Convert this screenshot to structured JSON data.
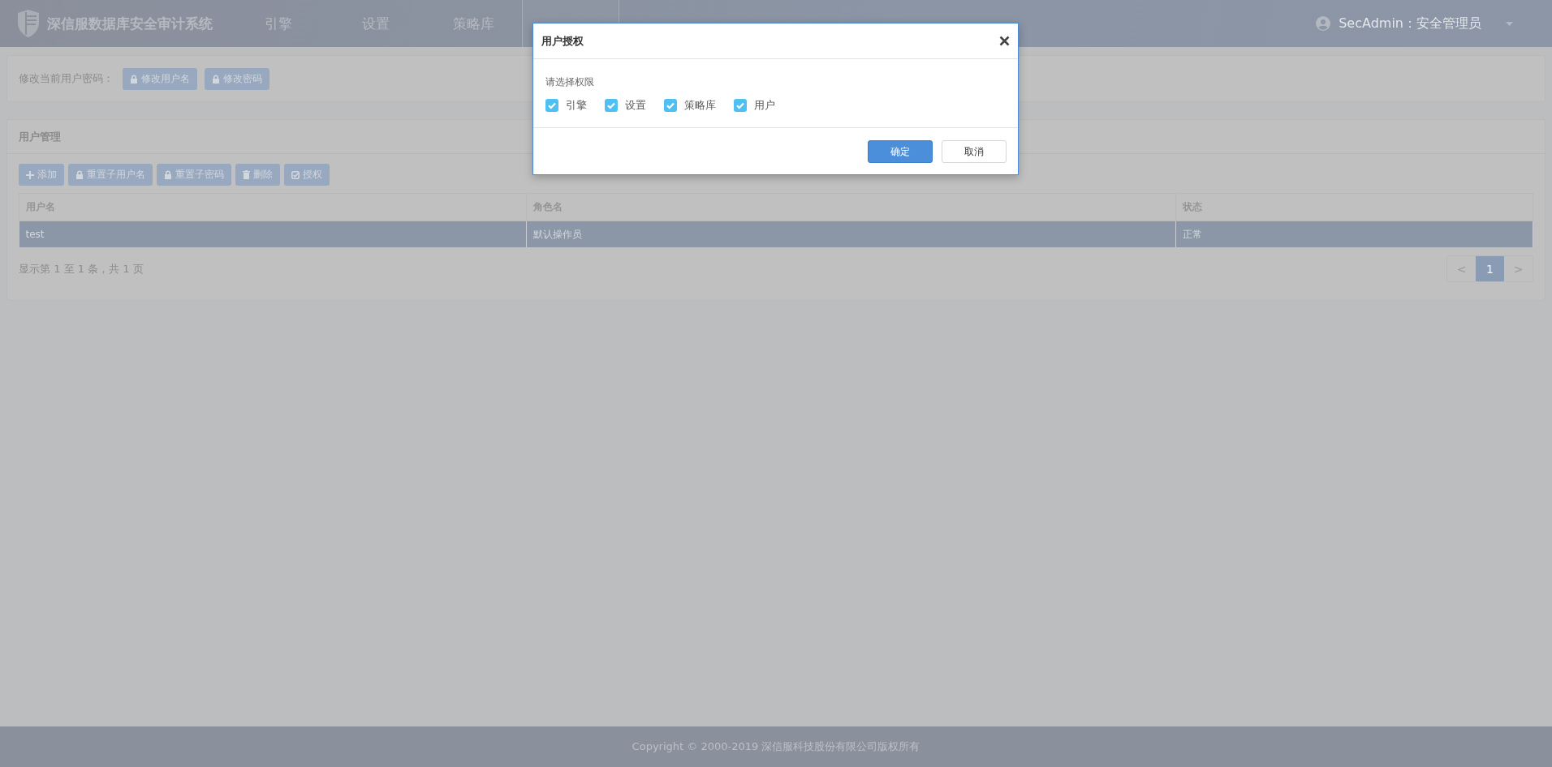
{
  "header": {
    "title": "深信服数据库安全审计系统",
    "nav": [
      {
        "label": "引擎",
        "selected": false
      },
      {
        "label": "设置",
        "selected": false
      },
      {
        "label": "策略库",
        "selected": false
      },
      {
        "selected": true
      }
    ],
    "user": "SecAdmin：安全管理员"
  },
  "account_panel": {
    "label": "修改当前用户密码：",
    "buttons": [
      "修改用户名",
      "修改密码"
    ]
  },
  "user_panel": {
    "title": "用户管理",
    "toolbar": [
      {
        "label": "添加",
        "kind": "plus"
      },
      {
        "label": "重置子用户名",
        "kind": "lock"
      },
      {
        "label": "重置子密码",
        "kind": "lock"
      },
      {
        "label": "删除",
        "kind": "trash"
      },
      {
        "label": "授权",
        "kind": "check"
      }
    ],
    "table": {
      "columns": [
        "用户名",
        "角色名",
        "状态"
      ],
      "rows": [
        {
          "cells": [
            "test",
            "默认操作员",
            "正常"
          ],
          "selected": true
        }
      ]
    },
    "info": "显示第 1 至 1 条，共 1 页",
    "pagination": [
      {
        "label": "<",
        "selected": false
      },
      {
        "label": "1",
        "selected": true
      },
      {
        "label": ">",
        "selected": false
      }
    ]
  },
  "dialog": {
    "title": "用户授权",
    "prompt": "请选择权限",
    "options": [
      {
        "label": "引擎",
        "checked": true
      },
      {
        "label": "设置",
        "checked": true
      },
      {
        "label": "策略库",
        "checked": true
      },
      {
        "label": "用户",
        "checked": true
      }
    ],
    "buttons": [
      {
        "label": "确定",
        "kind": "primary"
      },
      {
        "label": "取消",
        "kind": "default"
      }
    ]
  },
  "footer": "Copyright © 2000-2019 深信服科技股份有限公司版权所有"
}
